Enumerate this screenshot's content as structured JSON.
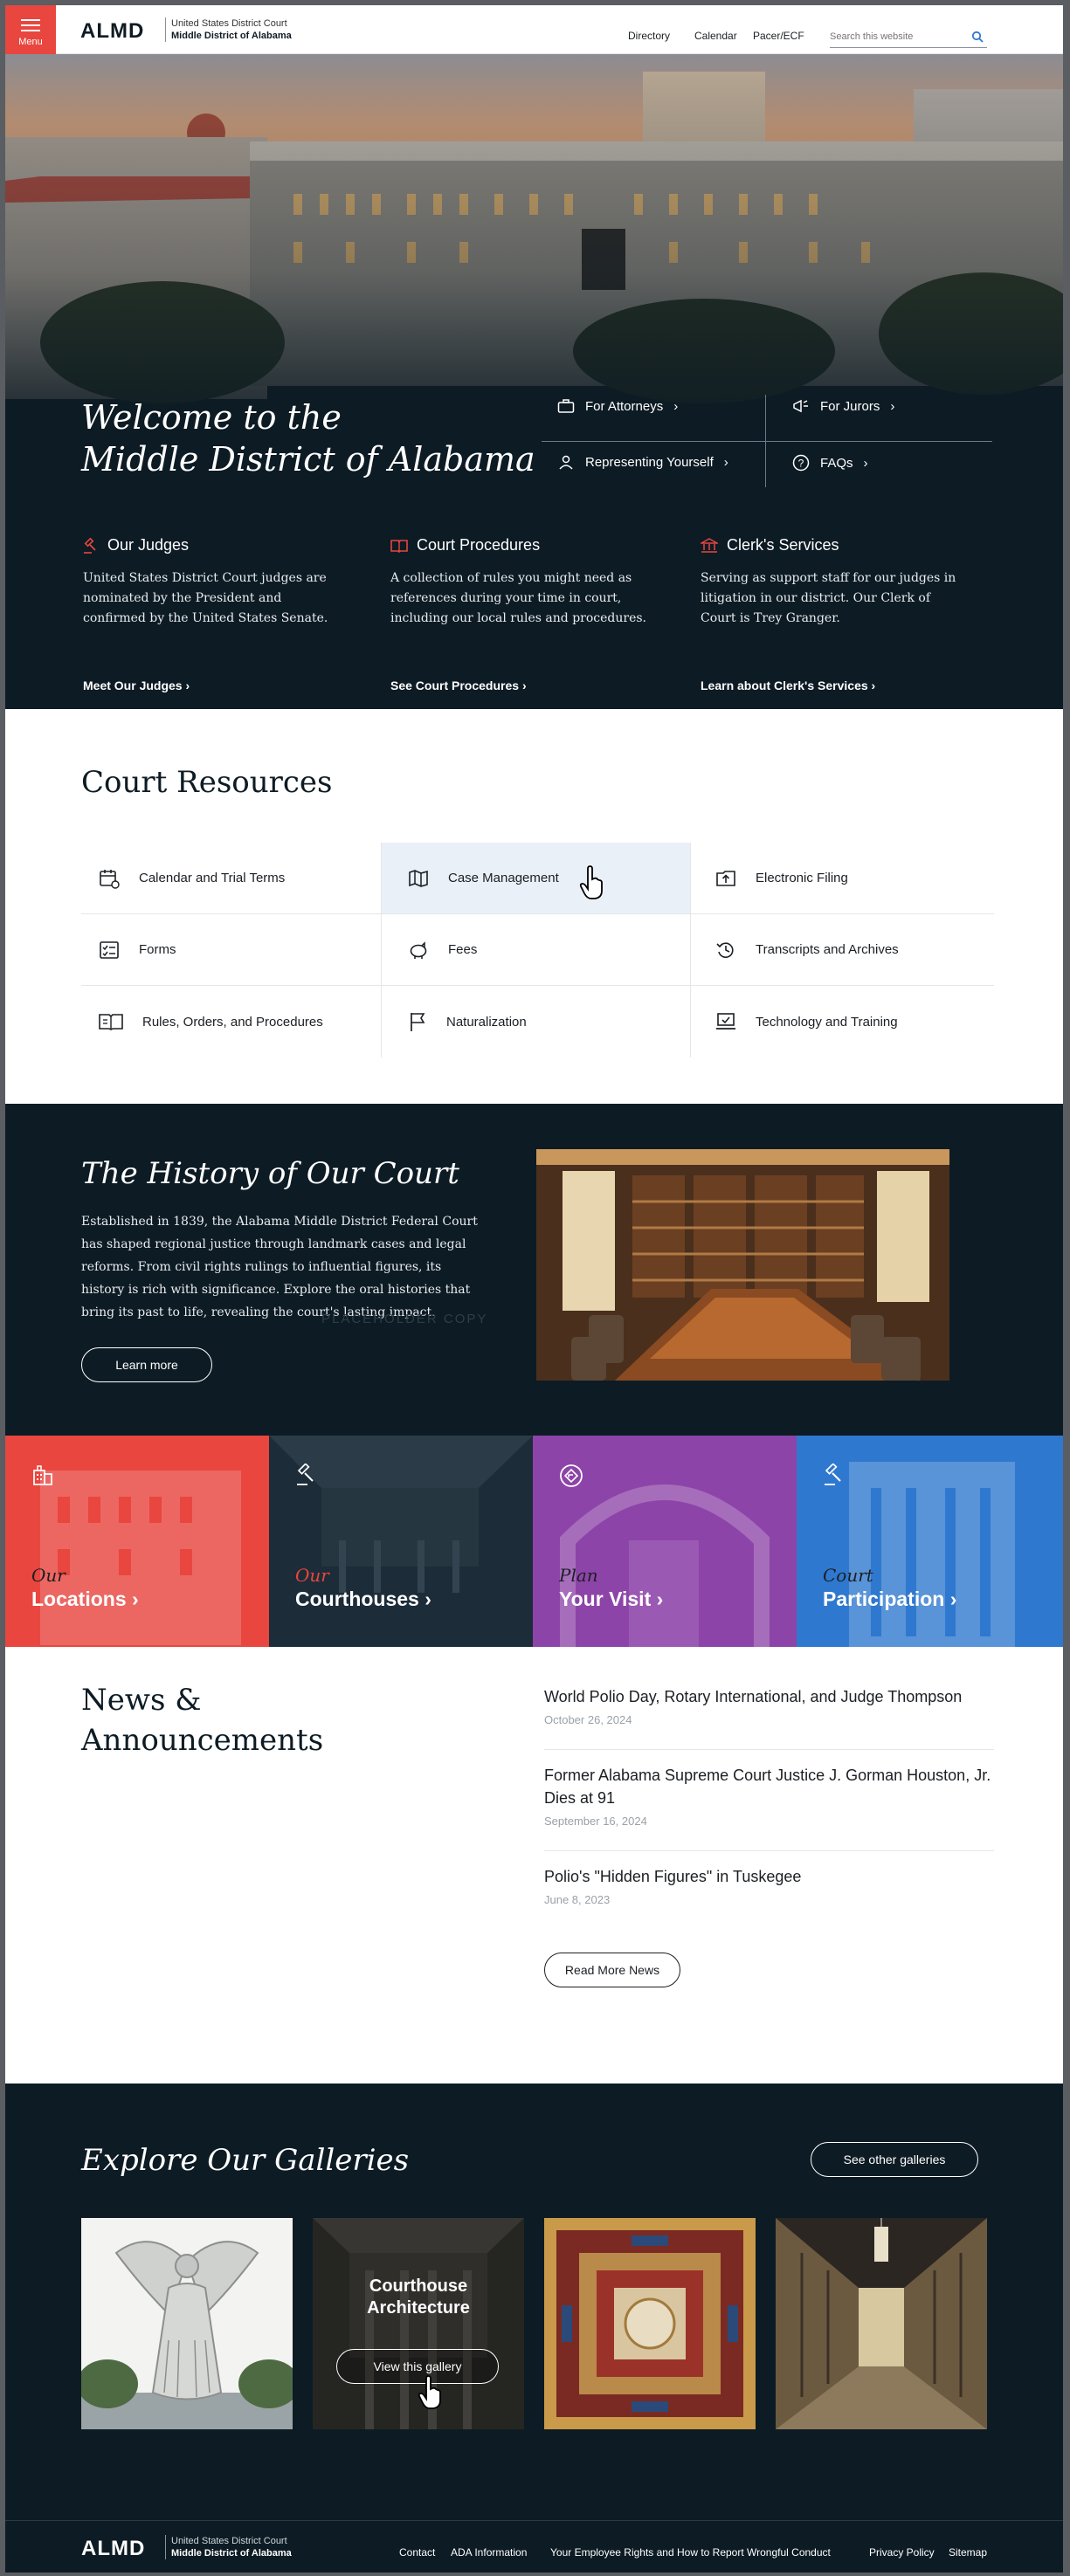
{
  "header": {
    "menu_label": "Menu",
    "logo": "ALMD",
    "court_line1": "United States District Court",
    "court_line2": "Middle District of Alabama",
    "nav": [
      "Directory",
      "Calendar",
      "Pacer/ECF"
    ],
    "search_placeholder": "Search this website"
  },
  "hero": {
    "title_line1": "Welcome to the",
    "title_line2": "Middle District of Alabama",
    "links": {
      "attorneys": "For Attorneys",
      "jurors": "For Jurors",
      "self": "Representing Yourself",
      "faqs": "FAQs"
    },
    "info": [
      {
        "title": "Our Judges",
        "text": "United States District Court judges are nominated by the President and confirmed by the United States Senate.",
        "link": "Meet Our Judges",
        "icon": "gavel-icon"
      },
      {
        "title": "Court Procedures",
        "text": "A collection of rules you might need as references during your time in court, including our local rules and procedures.",
        "link": "See Court Procedures",
        "icon": "book-open-icon"
      },
      {
        "title": "Clerk's Services",
        "text": "Serving as support staff for our judges in litigation in our district. Our Clerk of Court is Trey Granger.",
        "link": "Learn about Clerk's Services",
        "icon": "courthouse-icon"
      }
    ]
  },
  "resources": {
    "title": "Court Resources",
    "items": [
      {
        "label": "Calendar and Trial Terms",
        "icon": "calendar-icon"
      },
      {
        "label": "Case Management",
        "icon": "map-icon",
        "highlighted": true
      },
      {
        "label": "Electronic Filing",
        "icon": "upload-icon"
      },
      {
        "label": "Forms",
        "icon": "form-icon"
      },
      {
        "label": "Fees",
        "icon": "piggy-bank-icon"
      },
      {
        "label": "Transcripts and Archives",
        "icon": "history-icon"
      },
      {
        "label": "Rules, Orders, and Procedures",
        "icon": "book-icon"
      },
      {
        "label": "Naturalization",
        "icon": "flag-icon"
      },
      {
        "label": "Technology and Training",
        "icon": "laptop-check-icon"
      }
    ]
  },
  "history": {
    "title": "The History of Our Court",
    "text": "Established in 1839, the Alabama Middle District Federal Court has shaped regional justice through landmark cases and legal reforms. From civil rights rulings to influential figures, its history is rich with significance. Explore the oral histories that bring its past to life, revealing the court's lasting impact.",
    "placeholder": "PLACEHOLDER COPY",
    "button": "Learn more"
  },
  "tiles": [
    {
      "line1": "Our",
      "line2": "Locations",
      "color": "#e8463f",
      "icon": "buildings-icon"
    },
    {
      "line1": "Our",
      "line2": "Courthouses",
      "color": "#1c2c38",
      "icon": "gavel-icon"
    },
    {
      "line1": "Plan",
      "line2": "Your Visit",
      "color": "#8d44a8",
      "icon": "directions-icon"
    },
    {
      "line1": "Court",
      "line2": "Participation",
      "color": "#2f78cf",
      "icon": "gavel-icon"
    }
  ],
  "news": {
    "title_line1": "News &",
    "title_line2": "Announcements",
    "items": [
      {
        "title": "World Polio Day, Rotary International, and Judge Thompson",
        "date": "October 26, 2024"
      },
      {
        "title": "Former Alabama Supreme Court Justice J. Gorman Houston, Jr. Dies at 91",
        "date": "September 16, 2024"
      },
      {
        "title": "Polio's \"Hidden Figures\" in Tuskegee",
        "date": "June 8, 2023"
      }
    ],
    "button": "Read More News"
  },
  "galleries": {
    "title": "Explore Our Galleries",
    "other_button": "See other galleries",
    "caption_line1": "Courthouse",
    "caption_line2": "Architecture",
    "view_button": "View this gallery"
  },
  "footer": {
    "logo": "ALMD",
    "court_line1": "United States District Court",
    "court_line2": "Middle District of Alabama",
    "links": [
      "Contact",
      "ADA Information",
      "Your Employee Rights and How to Report Wrongful Conduct",
      "Privacy Policy",
      "Sitemap"
    ]
  },
  "colors": {
    "accent": "#e8463f",
    "navy": "#0d1b24",
    "purple": "#8d44a8",
    "blue": "#2f78cf"
  }
}
